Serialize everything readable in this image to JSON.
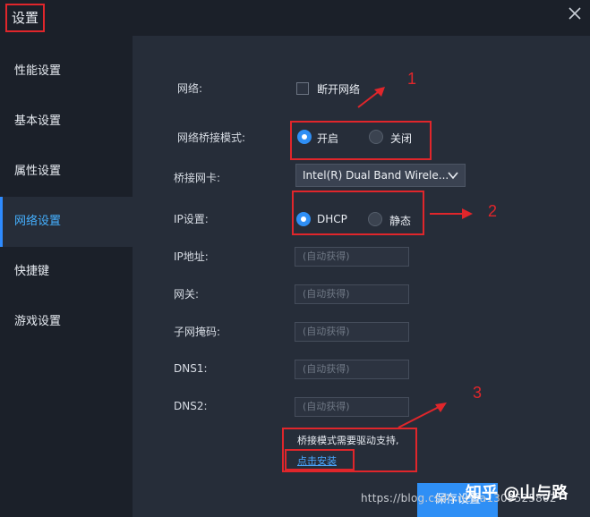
{
  "window": {
    "title": "设置"
  },
  "sidebar": {
    "items": [
      {
        "label": "性能设置"
      },
      {
        "label": "基本设置"
      },
      {
        "label": "属性设置"
      },
      {
        "label": "网络设置",
        "active": true
      },
      {
        "label": "快捷键"
      },
      {
        "label": "游戏设置"
      }
    ]
  },
  "network": {
    "net_label": "网络:",
    "disconnect_label": "断开网络",
    "disconnect_checked": false,
    "bridge_mode_label": "网络桥接模式:",
    "bridge_on_label": "开启",
    "bridge_off_label": "关闭",
    "bridge_selected": "开启",
    "bridge_nic_label": "桥接网卡:",
    "bridge_nic_value": "Intel(R) Dual Band Wirele...",
    "ip_setting_label": "IP设置:",
    "dhcp_label": "DHCP",
    "static_label": "静态",
    "ip_selected": "DHCP",
    "ip_addr_label": "IP地址:",
    "gateway_label": "网关:",
    "subnet_label": "子网掩码:",
    "dns1_label": "DNS1:",
    "dns2_label": "DNS2:",
    "auto_placeholder": "(自动获得)",
    "note": "桥接模式需要驱动支持,",
    "install_link": "点击安装",
    "save_button": "保存设置"
  },
  "annotations": {
    "num1": "1",
    "num2": "2",
    "num3": "3",
    "color": "#e0262b"
  },
  "watermark": {
    "url": "https://blog.csdn.net/a1309525802",
    "brand": "知乎 @山与路"
  },
  "colors": {
    "accent": "#2f8ff5",
    "sidebar_active_text": "#45b0ff",
    "link": "#4aa6ff"
  }
}
